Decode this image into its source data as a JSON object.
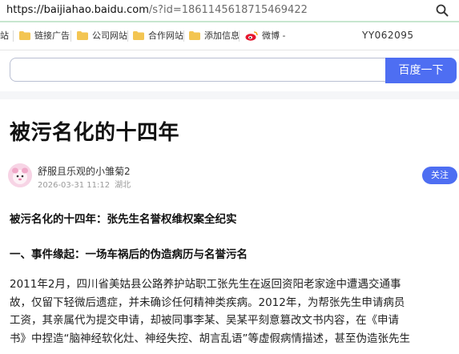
{
  "browser": {
    "url_host": "https://baijiahao.baidu.com",
    "url_path": "/s?id=1861145618715469422"
  },
  "bookmarks": {
    "items": [
      {
        "label": "站"
      },
      {
        "label": "链接广告"
      },
      {
        "label": "公司网站"
      },
      {
        "label": "合作网站"
      },
      {
        "label": "添加信息"
      },
      {
        "label": "微博 -"
      }
    ],
    "right_text": "YY062095"
  },
  "search": {
    "input_value": "",
    "button_label": "百度一下"
  },
  "article": {
    "title": "被污名化的十四年",
    "author": "舒服且乐观的小雏菊2",
    "date": "2026-03-31 11:12",
    "location": "湖北",
    "follow_label": "关注",
    "heading1": "被污名化的十四年：张先生名誉权维权案全纪实",
    "heading2": "一、事件缘起：一场车祸后的伪造病历与名誉污名",
    "paragraph_lines": [
      "2011年2月，四川省美姑县公路养护站职工张先生在返回资阳老家途中遭遇交通事",
      "故，仅留下轻微后遗症，并未确诊任何精神类疾病。2012年，为帮张先生申请病员",
      "工资，其亲属代为提交申请，却被同事李某、吴某平刻意篡改文书内容，在《申请",
      "书》中捏造“脑神经软化灶、神经失控、胡言乱语”等虚假病情描述，甚至伪造张先生"
    ]
  },
  "colors": {
    "accent": "#4e6ef2",
    "address_border": "#c7e6cf",
    "folder": "#f3c552"
  }
}
